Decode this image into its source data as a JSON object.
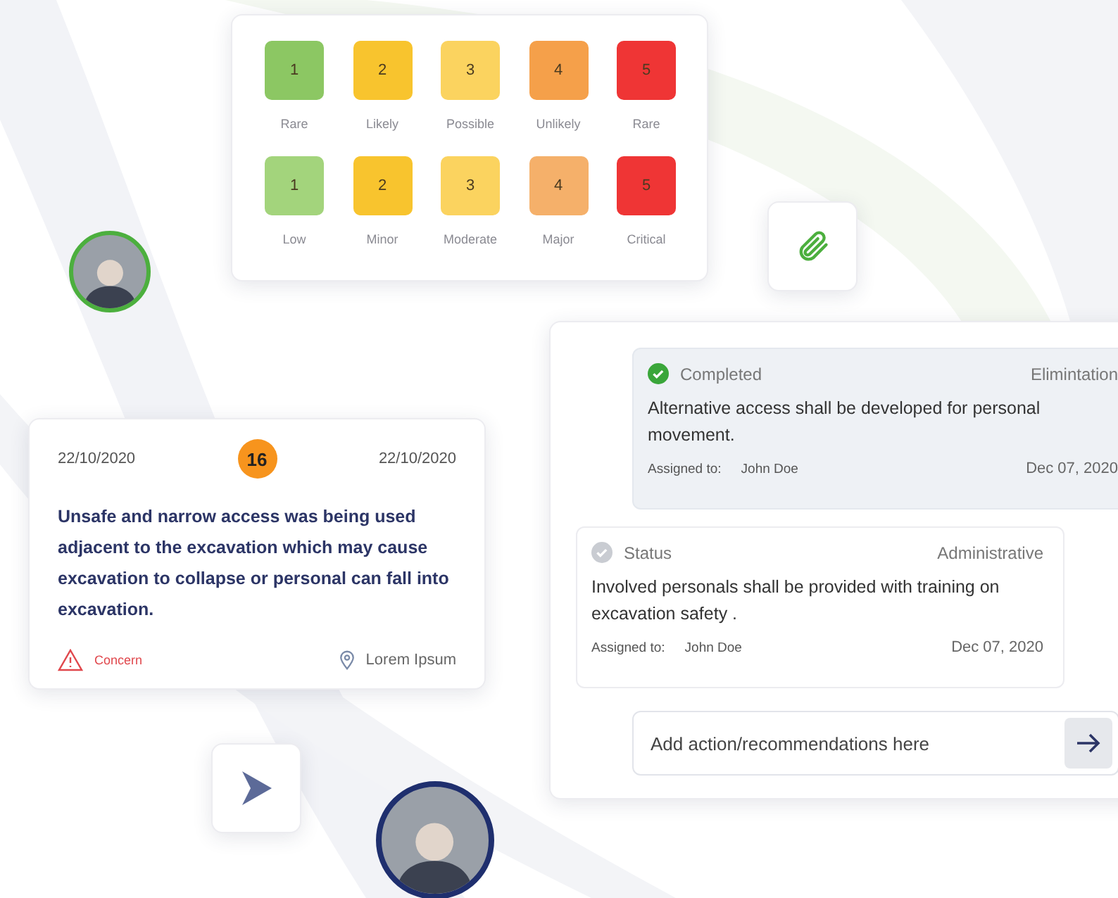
{
  "risk_matrix": {
    "likelihood": [
      {
        "value": "1",
        "label": "Rare",
        "color": "#8cc763"
      },
      {
        "value": "2",
        "label": "Likely",
        "color": "#f8c42e"
      },
      {
        "value": "3",
        "label": "Possible",
        "color": "#fbd35f"
      },
      {
        "value": "4",
        "label": "Unlikely",
        "color": "#f5a04a"
      },
      {
        "value": "5",
        "label": "Rare",
        "color": "#ef3535"
      }
    ],
    "severity": [
      {
        "value": "1",
        "label": "Low",
        "color": "#a3d47c"
      },
      {
        "value": "2",
        "label": "Minor",
        "color": "#f8c42e"
      },
      {
        "value": "3",
        "label": "Moderate",
        "color": "#fbd35f"
      },
      {
        "value": "4",
        "label": "Major",
        "color": "#f5b06a"
      },
      {
        "value": "5",
        "label": "Critical",
        "color": "#ef3535"
      }
    ]
  },
  "avatars": [
    {
      "color": "#4caf3e"
    },
    {
      "color": "#1f2f6e"
    }
  ],
  "concern_card": {
    "date_start": "22/10/2020",
    "score": "16",
    "date_end": "22/10/2020",
    "description": "Unsafe and narrow access was being used adjacent to the excavation which may cause excavation to collapse or personal can fall into excavation.",
    "tag": "Concern",
    "location": "Lorem Ipsum"
  },
  "actions": [
    {
      "completed": true,
      "status": "Completed",
      "category": "Elimintation",
      "text": "Alternative access shall be developed for personal movement.",
      "assigned_label": "Assigned to:",
      "assignee": "John Doe",
      "date": "Dec 07, 2020"
    },
    {
      "completed": false,
      "status": "Status",
      "category": "Administrative",
      "text": "Involved personals shall be provided with training on excavation safety .",
      "assigned_label": "Assigned to:",
      "assignee": "John Doe",
      "date": "Dec 07, 2020"
    }
  ],
  "action_input": {
    "placeholder": "Add action/recommendations here"
  }
}
